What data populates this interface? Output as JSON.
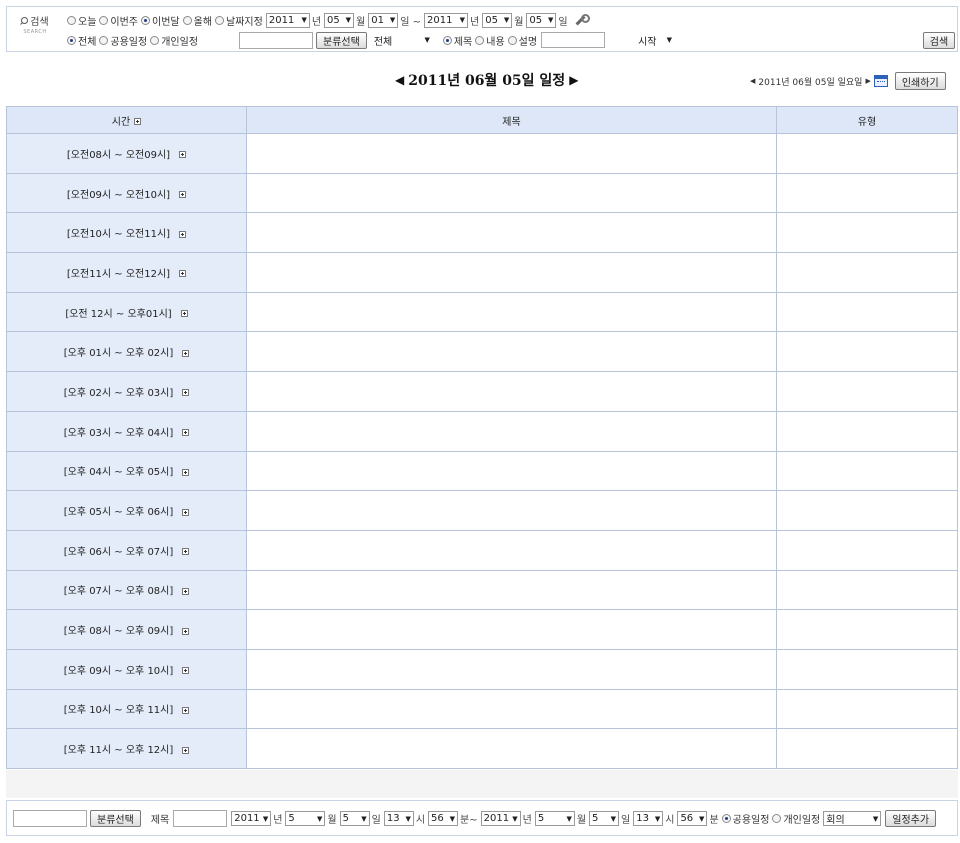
{
  "search": {
    "label": "검색",
    "label_en": "SEARCH",
    "period_options": [
      "오늘",
      "이번주",
      "이번달",
      "올해",
      "날짜지정"
    ],
    "period_selected": "이번달",
    "from": {
      "year": "2011",
      "month": "05",
      "day": "01"
    },
    "to": {
      "year": "2011",
      "month": "05",
      "day": "05"
    },
    "units": {
      "year": "년",
      "month": "월",
      "day": "일",
      "range_sep": "일 ~"
    },
    "scope_options": [
      "전체",
      "공용일정",
      "개인일정"
    ],
    "scope_selected": "전체",
    "category_button": "분류선택",
    "category_value": "전체",
    "field_options": [
      "제목",
      "내용",
      "설명"
    ],
    "field_selected": "제목",
    "sort_value": "시작",
    "search_button": "검색"
  },
  "header": {
    "title": "2011년 06월 05일 일정",
    "current_date": "2011년 06월 05일 일요일",
    "print_button": "인쇄하기"
  },
  "table": {
    "columns": [
      "시간",
      "제목",
      "유형"
    ],
    "rows": [
      "[오전08시 ~ 오전09시]",
      "[오전09시 ~ 오전10시]",
      "[오전10시 ~ 오전11시]",
      "[오전11시 ~ 오전12시]",
      "[오전 12시 ~ 오후01시]",
      "[오후 01시 ~ 오후 02시]",
      "[오후 02시 ~ 오후 03시]",
      "[오후 03시 ~ 오후 04시]",
      "[오후 04시 ~ 오후 05시]",
      "[오후 05시 ~ 오후 06시]",
      "[오후 06시 ~ 오후 07시]",
      "[오후 07시 ~ 오후 08시]",
      "[오후 08시 ~ 오후 09시]",
      "[오후 09시 ~ 오후 10시]",
      "[오후 10시 ~ 오후 11시]",
      "[오후 11시 ~ 오후 12시]"
    ]
  },
  "add": {
    "category_button": "분류선택",
    "title_label": "제목",
    "start": {
      "year": "2011",
      "month": "5",
      "day": "5",
      "hour": "13",
      "minute": "56"
    },
    "end": {
      "year": "2011",
      "month": "5",
      "day": "5",
      "hour": "13",
      "minute": "56"
    },
    "units": {
      "year": "년",
      "month": "월",
      "day": "일",
      "hour": "시",
      "minute": "분",
      "range_minute": "분~"
    },
    "scope_options": [
      "공용일정",
      "개인일정"
    ],
    "scope_selected": "공용일정",
    "type_value": "회의",
    "add_button": "일정추가"
  }
}
